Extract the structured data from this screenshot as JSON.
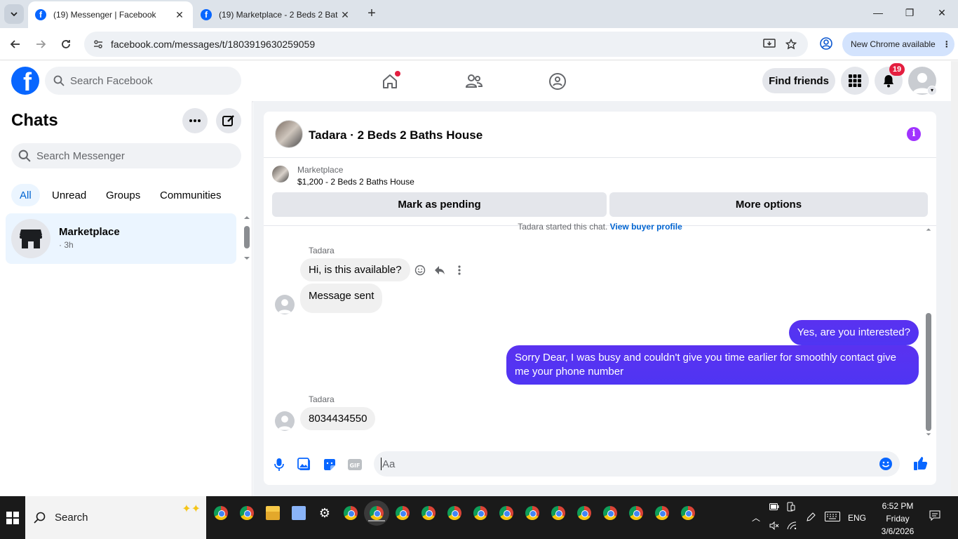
{
  "browser": {
    "tabs": [
      {
        "title": "(19) Messenger | Facebook",
        "active": true
      },
      {
        "title": "(19) Marketplace - 2 Beds 2 Bat",
        "active": false
      }
    ],
    "url": "facebook.com/messages/t/1803919630259059",
    "update_label": "New Chrome available"
  },
  "fb_header": {
    "search_placeholder": "Search Facebook",
    "find_friends_label": "Find friends",
    "notifications_count": "19"
  },
  "chat_list": {
    "title": "Chats",
    "search_placeholder": "Search Messenger",
    "filters": [
      "All",
      "Unread",
      "Groups",
      "Communities"
    ],
    "active_filter": "All",
    "items": [
      {
        "name": "Marketplace",
        "time": "· 3h"
      }
    ]
  },
  "conversation": {
    "title": "Tadara · 2 Beds 2 Baths House",
    "listing_source": "Marketplace",
    "listing_title": "$1,200 - 2 Beds 2 Baths House",
    "buttons": {
      "pending": "Mark as pending",
      "more": "More options"
    },
    "system_note": "Tadara started this chat.",
    "system_link": "View buyer profile",
    "messages": [
      {
        "sender": "Tadara",
        "text": "Hi, is this available?",
        "direction": "in"
      },
      {
        "sender": "",
        "text": "Message sent",
        "direction": "in"
      },
      {
        "sender": "",
        "text": "Yes, are you interested?",
        "direction": "out"
      },
      {
        "sender": "",
        "text": "Sorry Dear, I was busy and couldn't give you time earlier for smoothly contact give me your phone number",
        "direction": "out"
      },
      {
        "sender": "Tadara",
        "text": "8034434550",
        "direction": "in"
      }
    ],
    "composer_placeholder": "Aa"
  },
  "taskbar": {
    "search_label": "Search",
    "language": "ENG",
    "time": "6:52 PM",
    "day": "Friday",
    "date": "3/6/2026"
  },
  "colors": {
    "fb_blue": "#0866ff",
    "outgoing_bubble": "#5b2cf0",
    "active_filter_bg": "#ebf5ff",
    "notification_red": "#e41e3f"
  }
}
